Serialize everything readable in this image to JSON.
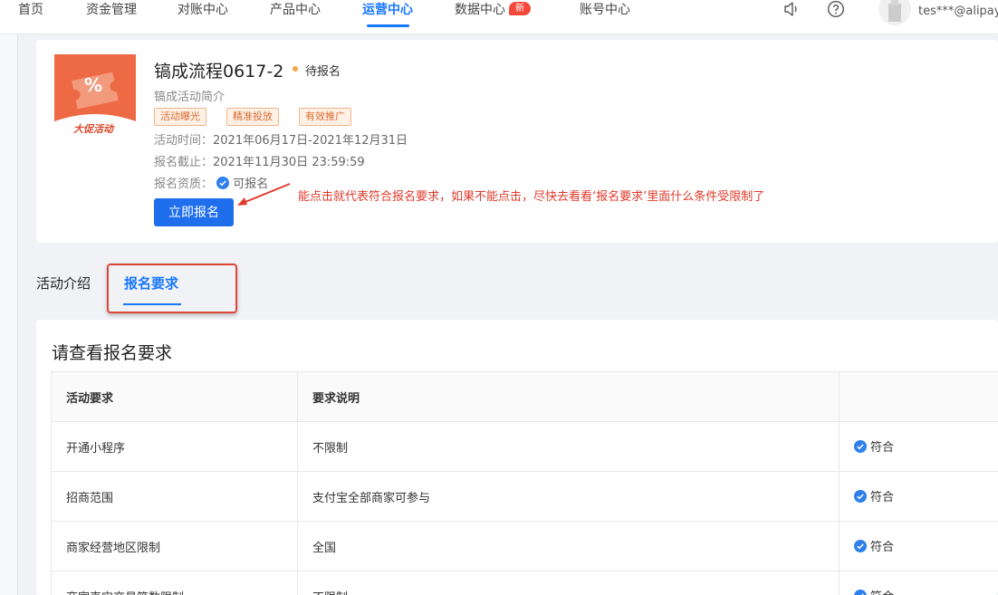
{
  "nav": {
    "items": [
      "首页",
      "资金管理",
      "对账中心",
      "产品中心",
      "运营中心",
      "数据中心",
      "账号中心"
    ],
    "badge": "新",
    "user": "tes***@alipay"
  },
  "activity": {
    "image_text": "%",
    "image_label": "大促活动",
    "title": "镐成流程0617-2",
    "status": "待报名",
    "intro": "镐成活动简介",
    "tags": [
      "活动曝光",
      "精准投放",
      "有效推广"
    ],
    "time_label": "活动时间：",
    "time_value": "2021年06月17日-2021年12月31日",
    "deadline_label": "报名截止：",
    "deadline_value": "2021年11月30日 23:59:59",
    "qual_label": "报名资质：",
    "qual_value": "可报名",
    "signup_button": "立即报名",
    "annotation": "能点击就代表符合报名要求，如果不能点击，尽快去看看‘报名要求’里面什么条件受限制了"
  },
  "tabs": [
    "活动介绍",
    "报名要求"
  ],
  "requirements": {
    "title": "请查看报名要求",
    "headers": [
      "活动要求",
      "要求说明",
      ""
    ],
    "rows": [
      {
        "name": "开通小程序",
        "desc": "不限制",
        "status": "符合"
      },
      {
        "name": "招商范围",
        "desc": "支付宝全部商家可参与",
        "status": "符合"
      },
      {
        "name": "商家经营地区限制",
        "desc": "全国",
        "status": "符合"
      },
      {
        "name": "商家真实交易笔数限制",
        "desc": "不限制",
        "status": "符合"
      }
    ]
  },
  "colors": {
    "accent": "#1677ff",
    "annotation": "#e03a2c",
    "ok": "#2f80ed"
  }
}
